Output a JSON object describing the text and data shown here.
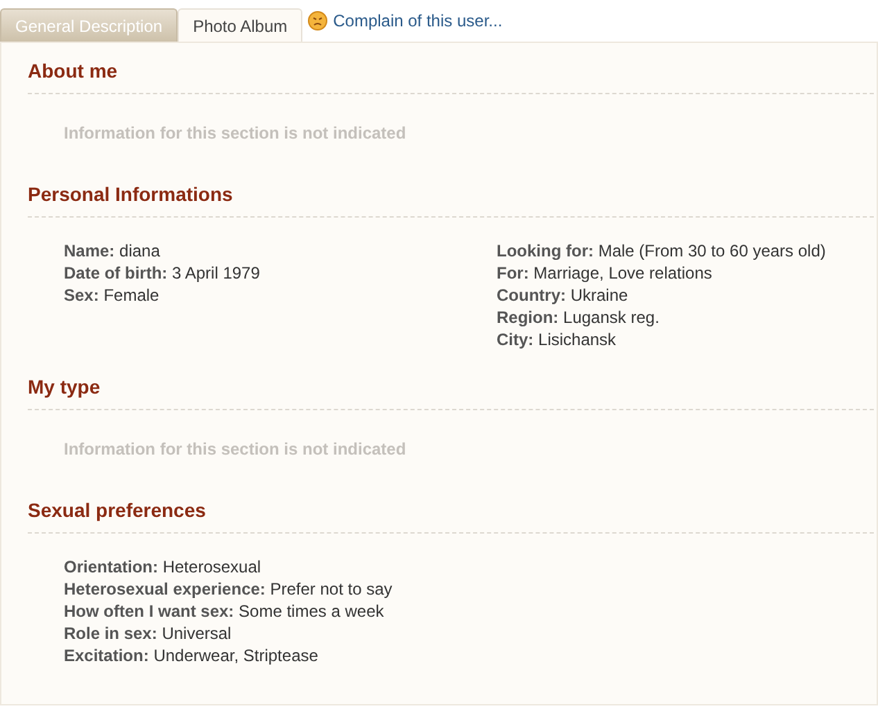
{
  "tabs": [
    {
      "label": "General Description",
      "selected": true
    },
    {
      "label": "Photo Album",
      "selected": false
    }
  ],
  "complain_link": "Complain of this user...",
  "sections": [
    {
      "title": "About me",
      "kind": "note",
      "note": "Information for this section is not indicated"
    },
    {
      "title": "Personal Informations",
      "kind": "columns",
      "columns": [
        [
          {
            "label": "Name:",
            "value": "diana"
          },
          {
            "label": "Date of birth:",
            "value": "3 April 1979"
          },
          {
            "label": "Sex:",
            "value": "Female"
          }
        ],
        [
          {
            "label": "Looking for:",
            "value": "Male (From 30 to 60 years old)"
          },
          {
            "label": "For:",
            "value": "Marriage, Love relations"
          },
          {
            "label": "Country:",
            "value": "Ukraine"
          },
          {
            "label": "Region:",
            "value": "Lugansk reg."
          },
          {
            "label": "City:",
            "value": "Lisichansk"
          }
        ]
      ]
    },
    {
      "title": "My type",
      "kind": "note",
      "note": "Information for this section is not indicated"
    },
    {
      "title": "Sexual preferences",
      "kind": "columns",
      "columns": [
        [
          {
            "label": "Orientation:",
            "value": "Heterosexual"
          },
          {
            "label": "Heterosexual experience:",
            "value": "Prefer not to say"
          },
          {
            "label": "How often I want sex:",
            "value": "Some times a week"
          },
          {
            "label": "Role in sex:",
            "value": "Universal"
          },
          {
            "label": "Excitation:",
            "value": "Underwear, Striptease"
          }
        ]
      ]
    }
  ]
}
